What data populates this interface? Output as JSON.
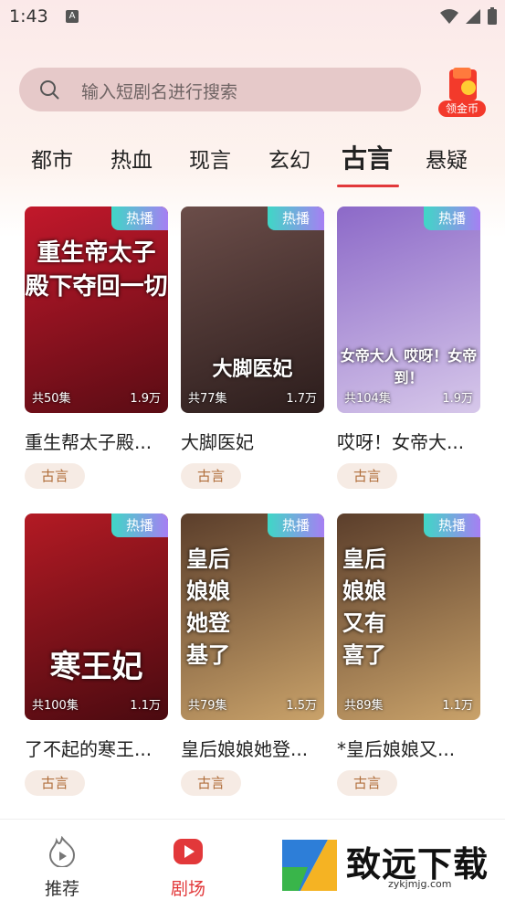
{
  "status": {
    "time": "1:43",
    "notif": "A"
  },
  "search": {
    "placeholder": "输入短剧名进行搜索"
  },
  "coin": {
    "label": "领金币"
  },
  "tabs": [
    {
      "label": "都市"
    },
    {
      "label": "热血"
    },
    {
      "label": "现言"
    },
    {
      "label": "玄幻"
    },
    {
      "label": "古言"
    },
    {
      "label": "悬疑"
    }
  ],
  "active_tab": "古言",
  "cards": [
    {
      "badge": "热播",
      "episodes": "共50集",
      "views": "1.9万",
      "title": "重生帮太子殿...",
      "tag": "古言",
      "poster_text": "重生帝太子 殿下夺回一切",
      "colors": [
        "#c2182b",
        "#5a0c14"
      ]
    },
    {
      "badge": "热播",
      "episodes": "共77集",
      "views": "1.7万",
      "title": "大脚医妃",
      "tag": "古言",
      "poster_text": "大脚医妃",
      "colors": [
        "#6b4d49",
        "#2c1d1c"
      ]
    },
    {
      "badge": "热播",
      "episodes": "共104集",
      "views": "1.9万",
      "title": "哎呀！女帝大...",
      "tag": "古言",
      "poster_text": "女帝大人 哎呀！女帝到！",
      "colors": [
        "#8c69c8",
        "#d7c8ea"
      ]
    },
    {
      "badge": "热播",
      "episodes": "共100集",
      "views": "1.1万",
      "title": "了不起的寒王...",
      "tag": "古言",
      "poster_text": "寒王妃",
      "colors": [
        "#b31a24",
        "#4a0a10"
      ]
    },
    {
      "badge": "热播",
      "episodes": "共79集",
      "views": "1.5万",
      "title": "皇后娘娘她登...",
      "tag": "古言",
      "poster_text": "皇后娘娘 她登基了",
      "colors": [
        "#5b3e2b",
        "#c9a26a"
      ]
    },
    {
      "badge": "热播",
      "episodes": "共89集",
      "views": "1.1万",
      "title": "*皇后娘娘又...",
      "tag": "古言",
      "poster_text": "皇后娘娘 又有喜了",
      "colors": [
        "#5b3e2b",
        "#c9a26a"
      ]
    }
  ],
  "nav": [
    {
      "label": "推荐",
      "color": "#333333"
    },
    {
      "label": "剧场",
      "color": "#e2383a"
    }
  ],
  "watermark": {
    "text": "致远下载",
    "url": "zykjmjg.com"
  },
  "accent": "#e2383a"
}
